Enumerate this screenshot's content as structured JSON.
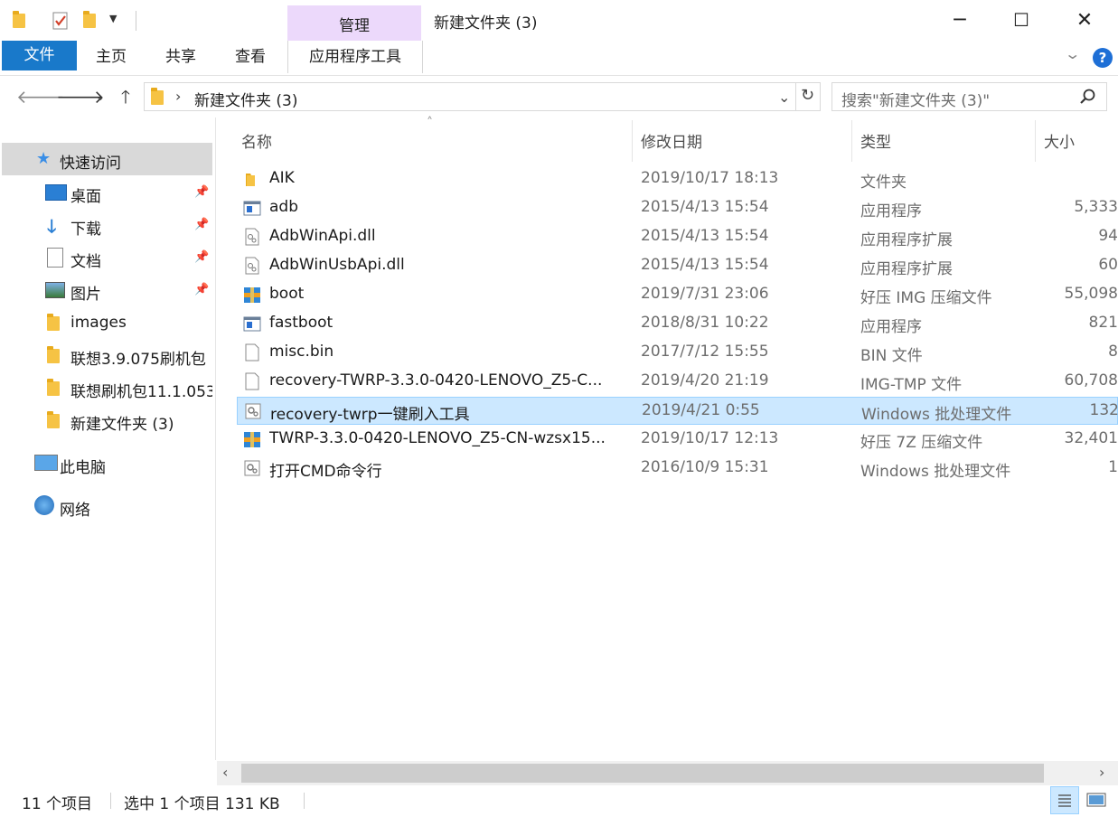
{
  "window": {
    "title": "新建文件夹 (3)",
    "contextual_group": "管理",
    "controls": {
      "minimize": "─",
      "maximize": "☐",
      "close": "✕"
    }
  },
  "ribbon": {
    "tabs": [
      "文件",
      "主页",
      "共享",
      "查看",
      "应用程序工具"
    ],
    "help": "?",
    "colors": {
      "file_tab": "#1979ca",
      "manage_tab": "#ecd9fb"
    }
  },
  "address": {
    "path": "新建文件夹 (3)",
    "search_placeholder": "搜索\"新建文件夹 (3)\""
  },
  "nav": {
    "quick_access": "快速访问",
    "items": [
      {
        "label": "桌面",
        "icon": "desktop-icon",
        "pinned": true
      },
      {
        "label": "下载",
        "icon": "download-icon",
        "pinned": true
      },
      {
        "label": "文档",
        "icon": "document-icon",
        "pinned": true
      },
      {
        "label": "图片",
        "icon": "pictures-icon",
        "pinned": true
      },
      {
        "label": "images",
        "icon": "folder-icon",
        "pinned": false
      },
      {
        "label": "联想3.9.075刷机包",
        "icon": "folder-icon",
        "pinned": false
      },
      {
        "label": "联想刷机包11.1.053",
        "icon": "folder-icon",
        "pinned": false
      },
      {
        "label": "新建文件夹 (3)",
        "icon": "folder-icon",
        "pinned": false
      }
    ],
    "this_pc": "此电脑",
    "network": "网络"
  },
  "columns": {
    "name": "名称",
    "date": "修改日期",
    "type": "类型",
    "size": "大小"
  },
  "files": [
    {
      "name": "AIK",
      "date": "2019/10/17 18:13",
      "type": "文件夹",
      "size": "",
      "icon": "folder-icon"
    },
    {
      "name": "adb",
      "date": "2015/4/13 15:54",
      "type": "应用程序",
      "size": "5,333",
      "icon": "exe-icon"
    },
    {
      "name": "AdbWinApi.dll",
      "date": "2015/4/13 15:54",
      "type": "应用程序扩展",
      "size": "94",
      "icon": "dll-icon"
    },
    {
      "name": "AdbWinUsbApi.dll",
      "date": "2015/4/13 15:54",
      "type": "应用程序扩展",
      "size": "60",
      "icon": "dll-icon"
    },
    {
      "name": "boot",
      "date": "2019/7/31 23:06",
      "type": "好压 IMG 压缩文件",
      "size": "55,098",
      "icon": "archive-icon"
    },
    {
      "name": "fastboot",
      "date": "2018/8/31 10:22",
      "type": "应用程序",
      "size": "821",
      "icon": "exe-icon"
    },
    {
      "name": "misc.bin",
      "date": "2017/7/12 15:55",
      "type": "BIN 文件",
      "size": "8",
      "icon": "blank-file-icon"
    },
    {
      "name": "recovery-TWRP-3.3.0-0420-LENOVO_Z5-C...",
      "date": "2019/4/20 21:19",
      "type": "IMG-TMP 文件",
      "size": "60,708",
      "icon": "blank-file-icon"
    },
    {
      "name": "recovery-twrp一键刷入工具",
      "date": "2019/4/21 0:55",
      "type": "Windows 批处理文件",
      "size": "132",
      "icon": "batch-icon",
      "selected": true
    },
    {
      "name": "TWRP-3.3.0-0420-LENOVO_Z5-CN-wzsx15...",
      "date": "2019/10/17 12:13",
      "type": "好压 7Z 压缩文件",
      "size": "32,401",
      "icon": "archive-icon"
    },
    {
      "name": "打开CMD命令行",
      "date": "2016/10/9 15:31",
      "type": "Windows 批处理文件",
      "size": "1",
      "icon": "batch-icon"
    }
  ],
  "status": {
    "count": "11 个项目",
    "selection": "选中 1 个项目  131 KB"
  }
}
